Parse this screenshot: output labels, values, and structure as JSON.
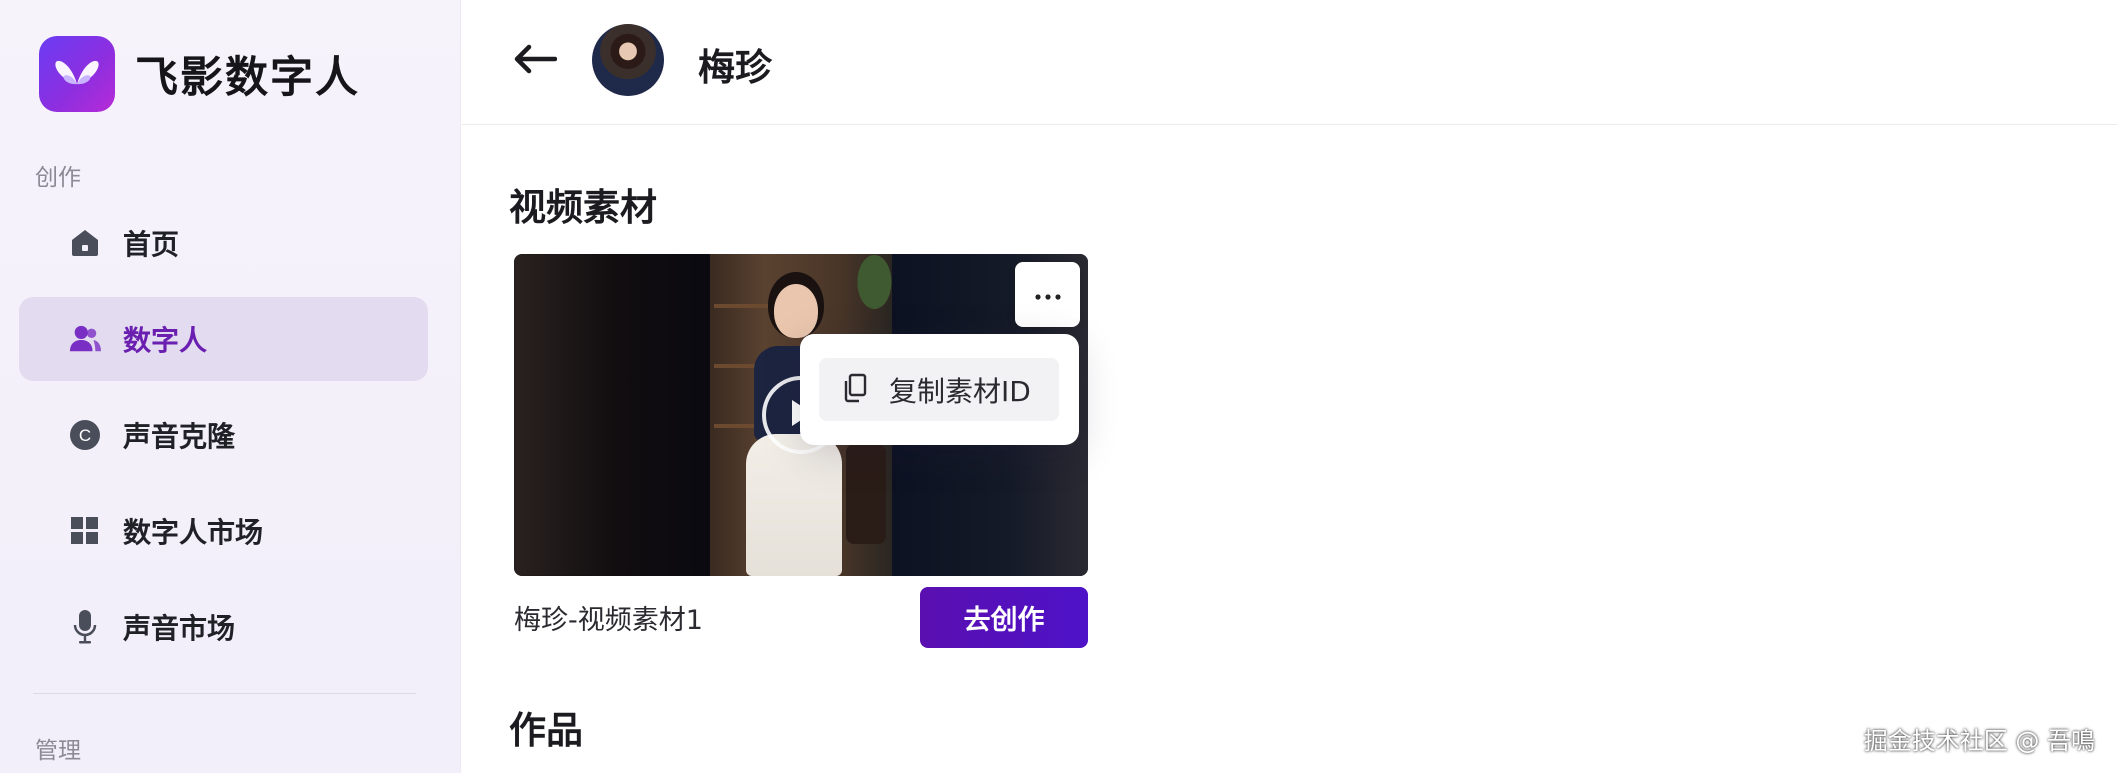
{
  "app": {
    "name": "飞影数字人"
  },
  "sidebar": {
    "section_create": "创作",
    "items": [
      {
        "label": "首页",
        "icon": "home-icon"
      },
      {
        "label": "数字人",
        "icon": "users-icon",
        "active": true
      },
      {
        "label": "声音克隆",
        "icon": "c-circle-icon"
      },
      {
        "label": "数字人市场",
        "icon": "grid-icon"
      },
      {
        "label": "声音市场",
        "icon": "microphone-icon"
      }
    ],
    "section_manage": "管理"
  },
  "header": {
    "name": "梅珍"
  },
  "main": {
    "video_section_title": "视频素材",
    "video": {
      "caption": "梅珍-视频素材1",
      "create_label": "去创作"
    },
    "menu": {
      "copy_id_label": "复制素材ID"
    },
    "works_section_title": "作品"
  },
  "watermark": "掘金技术社区 @ 吾鳴",
  "colors": {
    "accent": "#5a0fb0",
    "active_nav_bg": "#e3dcf0",
    "active_nav_text": "#6a1fb0"
  }
}
